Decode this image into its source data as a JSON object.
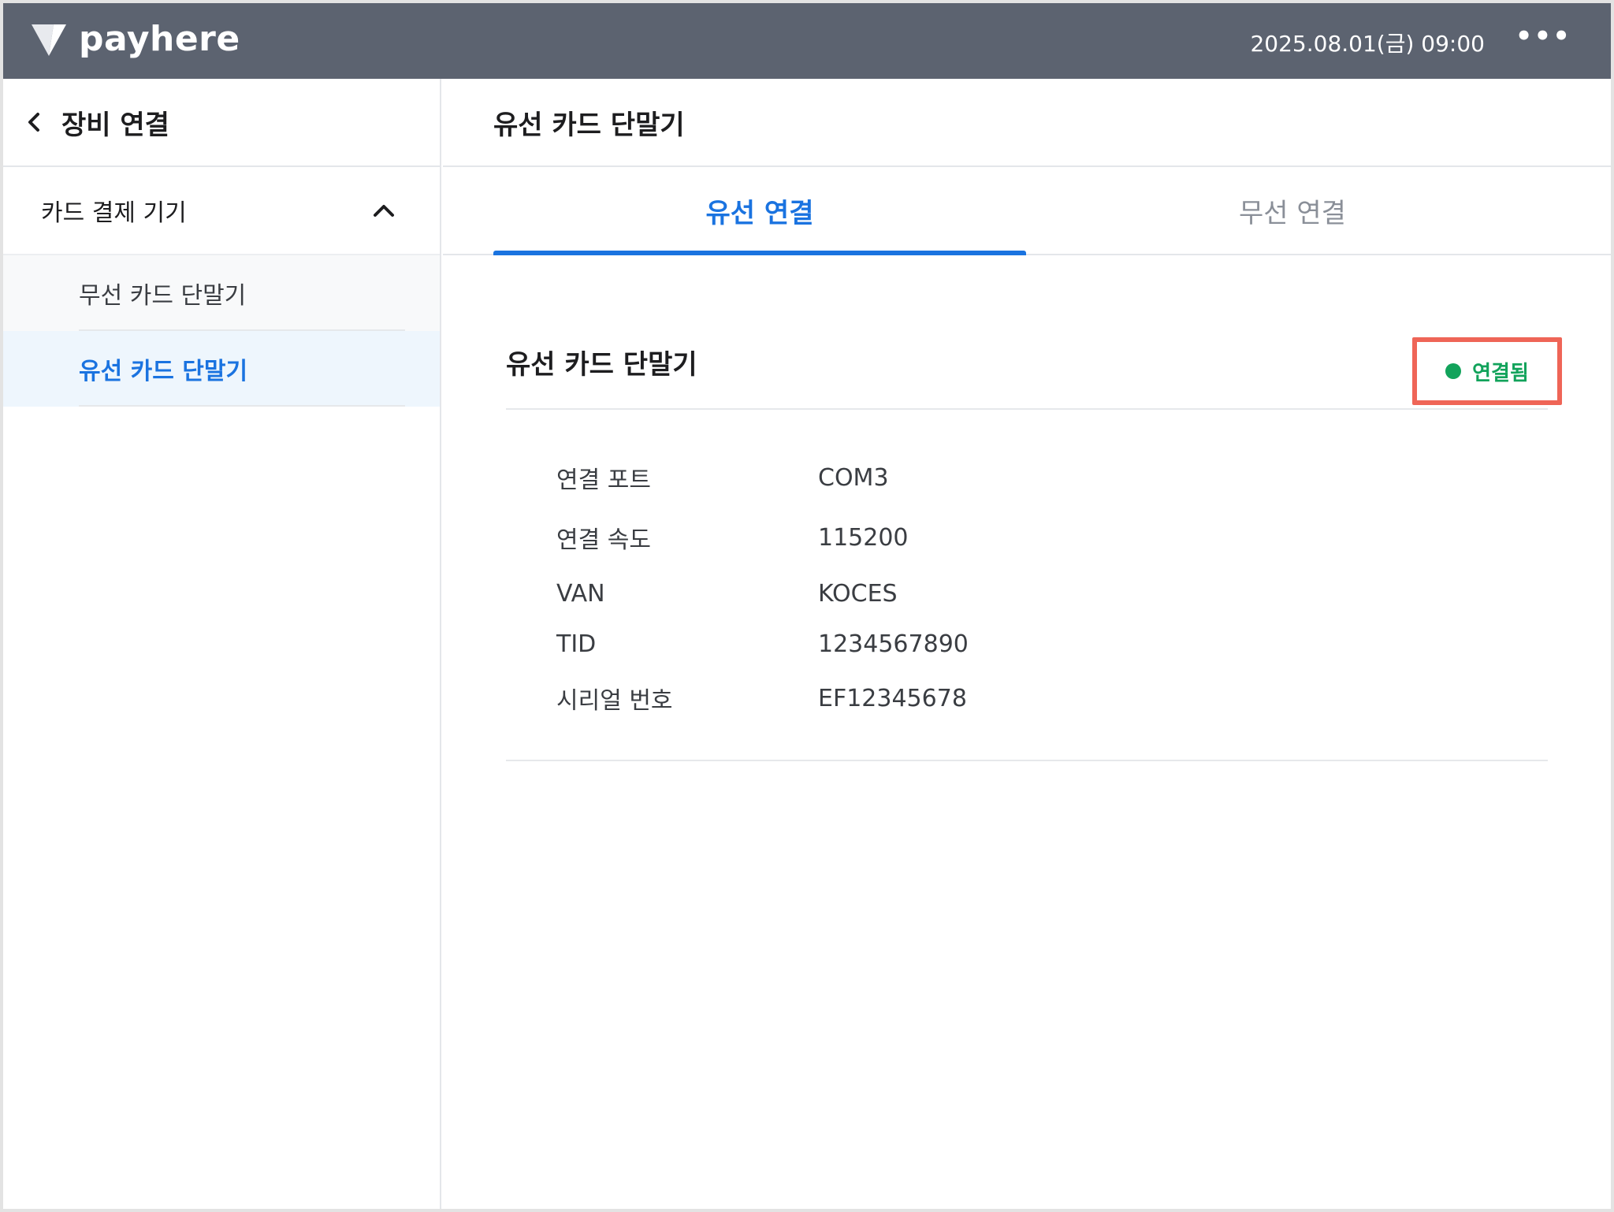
{
  "topbar": {
    "brand": "payhere",
    "datetime": "2025.08.01(금) 09:00",
    "more_label": "•••"
  },
  "sidebar": {
    "title": "장비 연결",
    "group_label": "카드 결제 기기",
    "items": [
      {
        "label": "무선 카드 단말기"
      },
      {
        "label": "유선 카드 단말기"
      }
    ]
  },
  "main": {
    "title": "유선 카드 단말기",
    "tabs": [
      {
        "label": "유선 연결"
      },
      {
        "label": "무선 연결"
      }
    ],
    "device": {
      "name": "유선 카드 단말기",
      "status": "연결됨",
      "status_color": "#12a35b",
      "info": [
        {
          "label": "연결 포트",
          "value": "COM3"
        },
        {
          "label": "연결 속도",
          "value": "115200"
        },
        {
          "label": "VAN",
          "value": "KOCES"
        },
        {
          "label": "TID",
          "value": "1234567890"
        },
        {
          "label": "시리얼 번호",
          "value": "EF12345678"
        }
      ]
    }
  },
  "icons": {
    "logo": "payhere-logo-icon",
    "back": "chevron-left-icon",
    "collapse": "chevron-up-icon",
    "more": "more-horizontal-icon"
  },
  "colors": {
    "topbar": "#5c6370",
    "accent": "#1a73e0",
    "status_connected": "#12a35b",
    "highlight_box": "#ef6557"
  }
}
